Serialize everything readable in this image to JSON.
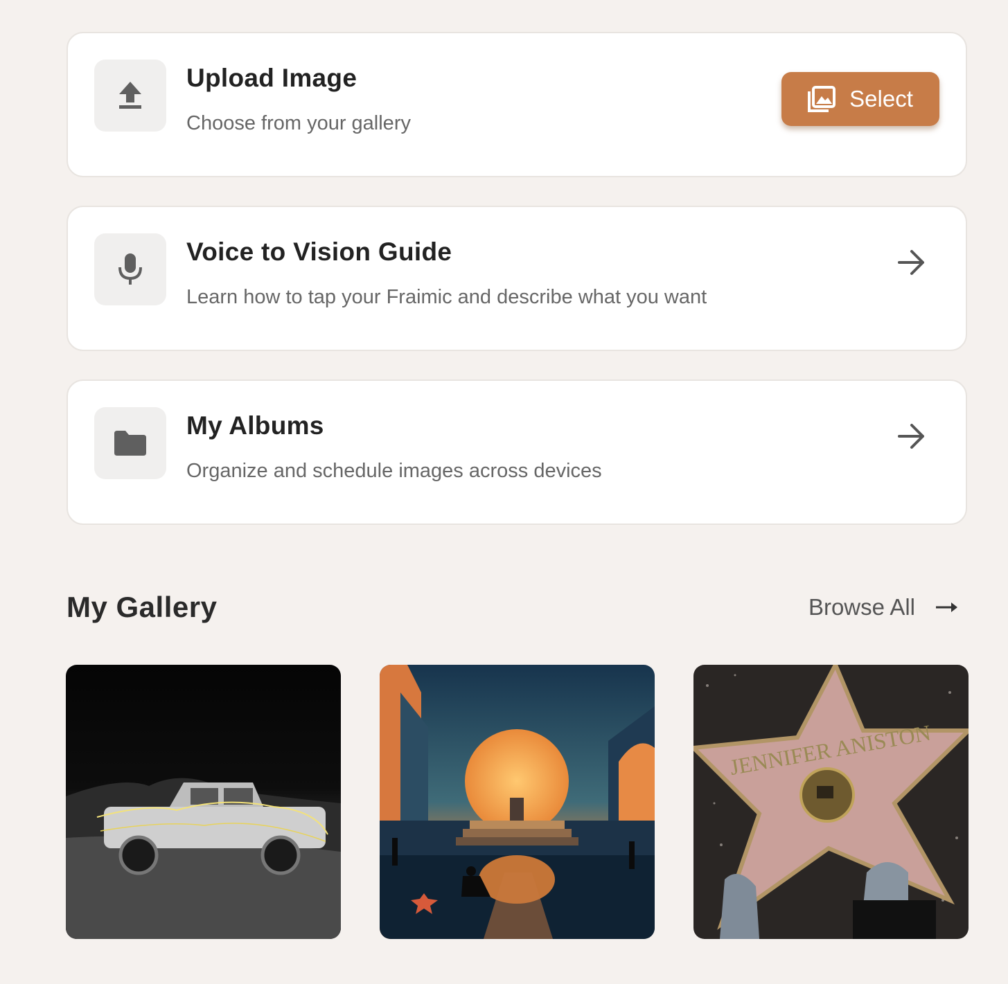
{
  "cards": [
    {
      "title": "Upload Image",
      "subtitle": "Choose from your gallery",
      "icon": "upload-icon",
      "action_label": "Select",
      "action_icon": "photo-library-icon"
    },
    {
      "title": "Voice to Vision Guide",
      "subtitle": "Learn how to tap your Fraimic and describe what you want",
      "icon": "microphone-icon"
    },
    {
      "title": "My Albums",
      "subtitle": "Organize and schedule images across devices",
      "icon": "folder-icon"
    }
  ],
  "gallery": {
    "title": "My Gallery",
    "browse_label": "Browse All",
    "items": [
      {
        "description": "pickup-truck-light-painting"
      },
      {
        "description": "sunset-city-stairs"
      },
      {
        "description": "walk-of-fame-star"
      }
    ],
    "star_text": "JENNIFER ANISTON"
  },
  "colors": {
    "accent": "#c77c48",
    "background": "#f5f1ee",
    "card": "#ffffff",
    "icon_bg": "#f0efee"
  }
}
